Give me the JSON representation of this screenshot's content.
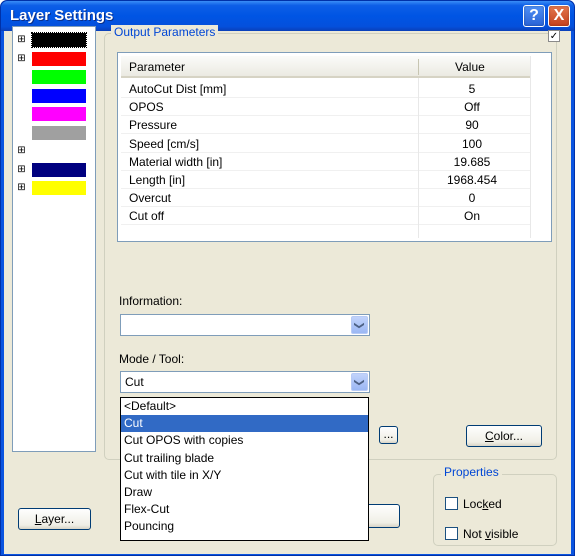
{
  "window": {
    "title": "Layer Settings",
    "help_glyph": "?",
    "close_glyph": "X"
  },
  "layers": [
    {
      "expander": "⊞",
      "color": "#000000",
      "selected": true
    },
    {
      "expander": "⊞",
      "color": "#ff0000"
    },
    {
      "expander": "",
      "color": "#00ff00"
    },
    {
      "expander": "",
      "color": "#0000ff"
    },
    {
      "expander": "",
      "color": "#ff00ff"
    },
    {
      "expander": "",
      "color": "#a0a0a0"
    },
    {
      "expander": "⊞",
      "color": ""
    },
    {
      "expander": "⊞",
      "color": "#00007f"
    },
    {
      "expander": "⊞",
      "color": "#ffff00"
    }
  ],
  "output_parameters": {
    "title": "Output Parameters",
    "checkbox_glyph": "✓",
    "columns": {
      "parameter": "Parameter",
      "value": "Value"
    },
    "rows": [
      {
        "parameter": "AutoCut Dist [mm]",
        "value": "5"
      },
      {
        "parameter": "OPOS",
        "value": "Off"
      },
      {
        "parameter": "Pressure",
        "value": "90"
      },
      {
        "parameter": "Speed [cm/s]",
        "value": "100"
      },
      {
        "parameter": "Material width [in]",
        "value": "19.685"
      },
      {
        "parameter": "Length [in]",
        "value": "1968.454"
      },
      {
        "parameter": "Overcut",
        "value": "0"
      },
      {
        "parameter": "Cut off",
        "value": "On"
      }
    ]
  },
  "information": {
    "label": "Information:",
    "value": "",
    "arrow": "❯"
  },
  "mode_tool": {
    "label": "Mode / Tool:",
    "value": "Cut",
    "arrow": "❯",
    "options": [
      "<Default>",
      "Cut",
      "Cut OPOS with copies",
      "Cut trailing blade",
      "Cut with tile in X/Y",
      "Draw",
      "Flex-Cut",
      "Pouncing"
    ],
    "selected_index": 1
  },
  "buttons": {
    "ellipsis": "...",
    "color_prefix": "",
    "color_u": "C",
    "color_rest": "olor...",
    "layer_u": "L",
    "layer_rest": "ayer..."
  },
  "properties": {
    "title": "Properties",
    "locked_prefix": "Loc",
    "locked_u": "k",
    "locked_rest": "ed",
    "not_visible_prefix": "Not ",
    "not_visible_u": "v",
    "not_visible_rest": "isible"
  },
  "colors": {
    "title_bar": "#0055e4",
    "selection": "#316ac5",
    "group_title": "#0046d5"
  }
}
